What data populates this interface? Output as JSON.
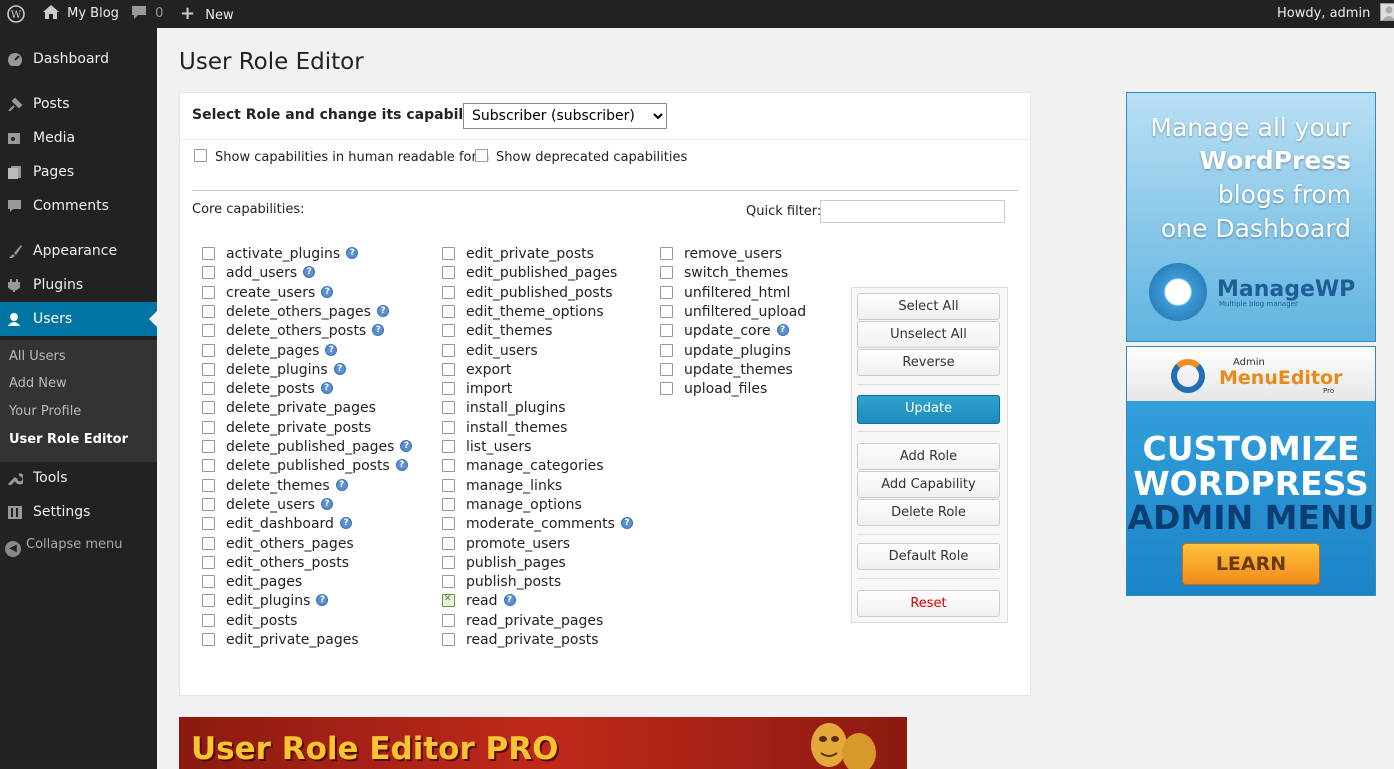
{
  "adminbar": {
    "site_name": "My Blog",
    "comments_count": "0",
    "new_label": "New",
    "greeting": "Howdy, admin"
  },
  "sidebar": {
    "items": [
      {
        "label": "Dashboard",
        "icon": "dashboard-icon"
      },
      {
        "label": "Posts",
        "icon": "pin-icon"
      },
      {
        "label": "Media",
        "icon": "media-icon"
      },
      {
        "label": "Pages",
        "icon": "pages-icon"
      },
      {
        "label": "Comments",
        "icon": "comment-icon"
      },
      {
        "label": "Appearance",
        "icon": "brush-icon"
      },
      {
        "label": "Plugins",
        "icon": "plug-icon"
      },
      {
        "label": "Users",
        "icon": "user-icon"
      },
      {
        "label": "Tools",
        "icon": "wrench-icon"
      },
      {
        "label": "Settings",
        "icon": "settings-icon"
      }
    ],
    "submenu": [
      "All Users",
      "Add New",
      "Your Profile",
      "User Role Editor"
    ],
    "collapse_label": "Collapse menu"
  },
  "page": {
    "title": "User Role Editor",
    "select_role_label": "Select Role and change its capabilities:",
    "selected_role": "Subscriber (subscriber)",
    "show_human_label": "Show capabilities in human readable form",
    "show_deprecated_label": "Show deprecated capabilities",
    "core_caps_label": "Core capabilities:",
    "quick_filter_label": "Quick filter:",
    "quick_filter_value": ""
  },
  "capabilities": [
    [
      {
        "name": "activate_plugins",
        "help": true,
        "checked": false
      },
      {
        "name": "add_users",
        "help": true,
        "checked": false
      },
      {
        "name": "create_users",
        "help": true,
        "checked": false
      },
      {
        "name": "delete_others_pages",
        "help": true,
        "checked": false
      },
      {
        "name": "delete_others_posts",
        "help": true,
        "checked": false
      },
      {
        "name": "delete_pages",
        "help": true,
        "checked": false
      },
      {
        "name": "delete_plugins",
        "help": true,
        "checked": false
      },
      {
        "name": "delete_posts",
        "help": true,
        "checked": false
      },
      {
        "name": "delete_private_pages",
        "help": false,
        "checked": false
      },
      {
        "name": "delete_private_posts",
        "help": false,
        "checked": false
      },
      {
        "name": "delete_published_pages",
        "help": true,
        "checked": false
      },
      {
        "name": "delete_published_posts",
        "help": true,
        "checked": false
      },
      {
        "name": "delete_themes",
        "help": true,
        "checked": false
      },
      {
        "name": "delete_users",
        "help": true,
        "checked": false
      },
      {
        "name": "edit_dashboard",
        "help": true,
        "checked": false
      },
      {
        "name": "edit_others_pages",
        "help": false,
        "checked": false
      },
      {
        "name": "edit_others_posts",
        "help": false,
        "checked": false
      },
      {
        "name": "edit_pages",
        "help": false,
        "checked": false
      },
      {
        "name": "edit_plugins",
        "help": true,
        "checked": false
      },
      {
        "name": "edit_posts",
        "help": false,
        "checked": false
      },
      {
        "name": "edit_private_pages",
        "help": false,
        "checked": false
      }
    ],
    [
      {
        "name": "edit_private_posts",
        "help": false,
        "checked": false
      },
      {
        "name": "edit_published_pages",
        "help": false,
        "checked": false
      },
      {
        "name": "edit_published_posts",
        "help": false,
        "checked": false
      },
      {
        "name": "edit_theme_options",
        "help": false,
        "checked": false
      },
      {
        "name": "edit_themes",
        "help": false,
        "checked": false
      },
      {
        "name": "edit_users",
        "help": false,
        "checked": false
      },
      {
        "name": "export",
        "help": false,
        "checked": false
      },
      {
        "name": "import",
        "help": false,
        "checked": false
      },
      {
        "name": "install_plugins",
        "help": false,
        "checked": false
      },
      {
        "name": "install_themes",
        "help": false,
        "checked": false
      },
      {
        "name": "list_users",
        "help": false,
        "checked": false
      },
      {
        "name": "manage_categories",
        "help": false,
        "checked": false
      },
      {
        "name": "manage_links",
        "help": false,
        "checked": false
      },
      {
        "name": "manage_options",
        "help": false,
        "checked": false
      },
      {
        "name": "moderate_comments",
        "help": true,
        "checked": false
      },
      {
        "name": "promote_users",
        "help": false,
        "checked": false
      },
      {
        "name": "publish_pages",
        "help": false,
        "checked": false
      },
      {
        "name": "publish_posts",
        "help": false,
        "checked": false
      },
      {
        "name": "read",
        "help": true,
        "checked": true
      },
      {
        "name": "read_private_pages",
        "help": false,
        "checked": false
      },
      {
        "name": "read_private_posts",
        "help": false,
        "checked": false
      }
    ],
    [
      {
        "name": "remove_users",
        "help": false,
        "checked": false
      },
      {
        "name": "switch_themes",
        "help": false,
        "checked": false
      },
      {
        "name": "unfiltered_html",
        "help": false,
        "checked": false
      },
      {
        "name": "unfiltered_upload",
        "help": false,
        "checked": false
      },
      {
        "name": "update_core",
        "help": true,
        "checked": false
      },
      {
        "name": "update_plugins",
        "help": false,
        "checked": false
      },
      {
        "name": "update_themes",
        "help": false,
        "checked": false
      },
      {
        "name": "upload_files",
        "help": false,
        "checked": false
      }
    ]
  ],
  "buttons": {
    "select_all": "Select All",
    "unselect_all": "Unselect All",
    "reverse": "Reverse",
    "update": "Update",
    "add_role": "Add Role",
    "add_capability": "Add Capability",
    "delete_role": "Delete Role",
    "default_role": "Default Role",
    "reset": "Reset"
  },
  "ads": {
    "managewp_lines": [
      "Manage all your",
      "WordPress",
      "blogs from",
      "one Dashboard"
    ],
    "managewp_brand": "ManageWP",
    "managewp_tagline": "Multiple blog manager",
    "ame_small": "Admin",
    "ame_name": "MenuEditor",
    "ame_pro": "Pro",
    "ame_lines": [
      "CUSTOMIZE",
      "WORDPRESS",
      "ADMIN MENU"
    ],
    "ame_cta": "LEARN MORE",
    "banner_text": "User Role Editor PRO"
  }
}
